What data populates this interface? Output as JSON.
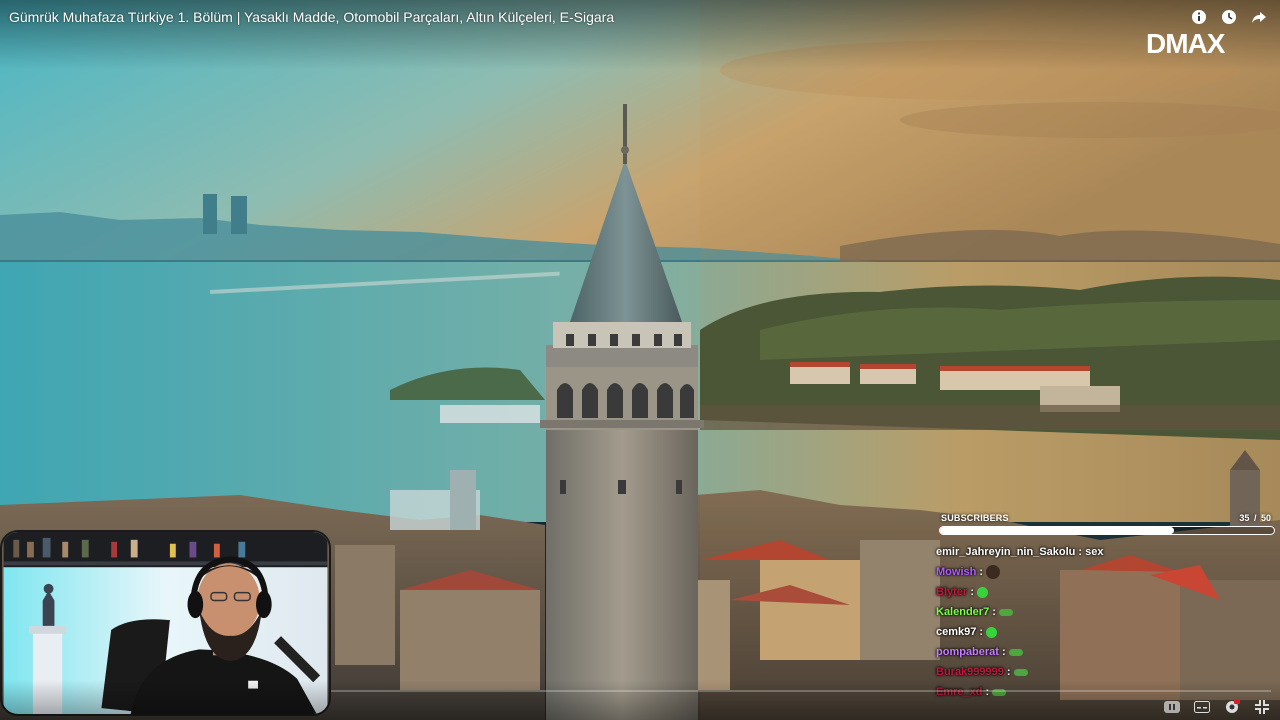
{
  "video": {
    "title": "Gümrük Muhafaza Türkiye 1. Bölüm | Yasaklı Madde, Otomobil Parçaları, Altın Külçeleri, E-Sigara",
    "channel_logo": "DMAX"
  },
  "top_icons": [
    "info-icon",
    "watch-later-icon",
    "share-icon"
  ],
  "subscribers": {
    "label": "SUBSCRIBERS",
    "current": "35",
    "separator": "/",
    "goal": "50",
    "progress_fraction": 0.7
  },
  "chat": [
    {
      "user": "emir_Jahreyin_nin_Sakolu",
      "color": "#ffffff",
      "message": "sex"
    },
    {
      "user": "Mowish",
      "color": "#b05cff",
      "message": "",
      "emote": "dark"
    },
    {
      "user": "Blyter",
      "color": "#c0183c",
      "message": "",
      "emote": "green"
    },
    {
      "user": "Kalender7",
      "color": "#7cff4a",
      "message": "",
      "emote": "green-small"
    },
    {
      "user": "cemk97",
      "color": "#ffffff",
      "message": "",
      "emote": "green"
    },
    {
      "user": "pompaberat",
      "color": "#c77dff",
      "message": "",
      "emote": "green-small"
    },
    {
      "user": "Burak999999",
      "color": "#c0183c",
      "message": "",
      "emote": "green-small"
    },
    {
      "user": "Emre_xd",
      "color": "#c0183c",
      "message": "",
      "emote": "green-small"
    }
  ],
  "bottom_controls": [
    "pause-icon",
    "captions-icon",
    "settings-icon",
    "fullscreen-exit-icon"
  ],
  "colors": {
    "sky_top": "#4fb8c4",
    "sky_warm": "#c9a06a",
    "sea": "#5aa8b0",
    "tower": "#8f8a80"
  }
}
